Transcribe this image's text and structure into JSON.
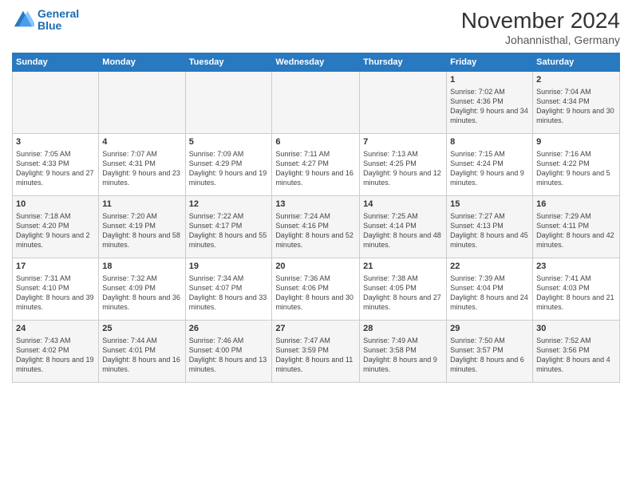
{
  "header": {
    "logo_line1": "General",
    "logo_line2": "Blue",
    "month": "November 2024",
    "location": "Johannisthal, Germany"
  },
  "days_of_week": [
    "Sunday",
    "Monday",
    "Tuesday",
    "Wednesday",
    "Thursday",
    "Friday",
    "Saturday"
  ],
  "weeks": [
    [
      {
        "day": "",
        "info": ""
      },
      {
        "day": "",
        "info": ""
      },
      {
        "day": "",
        "info": ""
      },
      {
        "day": "",
        "info": ""
      },
      {
        "day": "",
        "info": ""
      },
      {
        "day": "1",
        "info": "Sunrise: 7:02 AM\nSunset: 4:36 PM\nDaylight: 9 hours and 34 minutes."
      },
      {
        "day": "2",
        "info": "Sunrise: 7:04 AM\nSunset: 4:34 PM\nDaylight: 9 hours and 30 minutes."
      }
    ],
    [
      {
        "day": "3",
        "info": "Sunrise: 7:05 AM\nSunset: 4:33 PM\nDaylight: 9 hours and 27 minutes."
      },
      {
        "day": "4",
        "info": "Sunrise: 7:07 AM\nSunset: 4:31 PM\nDaylight: 9 hours and 23 minutes."
      },
      {
        "day": "5",
        "info": "Sunrise: 7:09 AM\nSunset: 4:29 PM\nDaylight: 9 hours and 19 minutes."
      },
      {
        "day": "6",
        "info": "Sunrise: 7:11 AM\nSunset: 4:27 PM\nDaylight: 9 hours and 16 minutes."
      },
      {
        "day": "7",
        "info": "Sunrise: 7:13 AM\nSunset: 4:25 PM\nDaylight: 9 hours and 12 minutes."
      },
      {
        "day": "8",
        "info": "Sunrise: 7:15 AM\nSunset: 4:24 PM\nDaylight: 9 hours and 9 minutes."
      },
      {
        "day": "9",
        "info": "Sunrise: 7:16 AM\nSunset: 4:22 PM\nDaylight: 9 hours and 5 minutes."
      }
    ],
    [
      {
        "day": "10",
        "info": "Sunrise: 7:18 AM\nSunset: 4:20 PM\nDaylight: 9 hours and 2 minutes."
      },
      {
        "day": "11",
        "info": "Sunrise: 7:20 AM\nSunset: 4:19 PM\nDaylight: 8 hours and 58 minutes."
      },
      {
        "day": "12",
        "info": "Sunrise: 7:22 AM\nSunset: 4:17 PM\nDaylight: 8 hours and 55 minutes."
      },
      {
        "day": "13",
        "info": "Sunrise: 7:24 AM\nSunset: 4:16 PM\nDaylight: 8 hours and 52 minutes."
      },
      {
        "day": "14",
        "info": "Sunrise: 7:25 AM\nSunset: 4:14 PM\nDaylight: 8 hours and 48 minutes."
      },
      {
        "day": "15",
        "info": "Sunrise: 7:27 AM\nSunset: 4:13 PM\nDaylight: 8 hours and 45 minutes."
      },
      {
        "day": "16",
        "info": "Sunrise: 7:29 AM\nSunset: 4:11 PM\nDaylight: 8 hours and 42 minutes."
      }
    ],
    [
      {
        "day": "17",
        "info": "Sunrise: 7:31 AM\nSunset: 4:10 PM\nDaylight: 8 hours and 39 minutes."
      },
      {
        "day": "18",
        "info": "Sunrise: 7:32 AM\nSunset: 4:09 PM\nDaylight: 8 hours and 36 minutes."
      },
      {
        "day": "19",
        "info": "Sunrise: 7:34 AM\nSunset: 4:07 PM\nDaylight: 8 hours and 33 minutes."
      },
      {
        "day": "20",
        "info": "Sunrise: 7:36 AM\nSunset: 4:06 PM\nDaylight: 8 hours and 30 minutes."
      },
      {
        "day": "21",
        "info": "Sunrise: 7:38 AM\nSunset: 4:05 PM\nDaylight: 8 hours and 27 minutes."
      },
      {
        "day": "22",
        "info": "Sunrise: 7:39 AM\nSunset: 4:04 PM\nDaylight: 8 hours and 24 minutes."
      },
      {
        "day": "23",
        "info": "Sunrise: 7:41 AM\nSunset: 4:03 PM\nDaylight: 8 hours and 21 minutes."
      }
    ],
    [
      {
        "day": "24",
        "info": "Sunrise: 7:43 AM\nSunset: 4:02 PM\nDaylight: 8 hours and 19 minutes."
      },
      {
        "day": "25",
        "info": "Sunrise: 7:44 AM\nSunset: 4:01 PM\nDaylight: 8 hours and 16 minutes."
      },
      {
        "day": "26",
        "info": "Sunrise: 7:46 AM\nSunset: 4:00 PM\nDaylight: 8 hours and 13 minutes."
      },
      {
        "day": "27",
        "info": "Sunrise: 7:47 AM\nSunset: 3:59 PM\nDaylight: 8 hours and 11 minutes."
      },
      {
        "day": "28",
        "info": "Sunrise: 7:49 AM\nSunset: 3:58 PM\nDaylight: 8 hours and 9 minutes."
      },
      {
        "day": "29",
        "info": "Sunrise: 7:50 AM\nSunset: 3:57 PM\nDaylight: 8 hours and 6 minutes."
      },
      {
        "day": "30",
        "info": "Sunrise: 7:52 AM\nSunset: 3:56 PM\nDaylight: 8 hours and 4 minutes."
      }
    ]
  ]
}
